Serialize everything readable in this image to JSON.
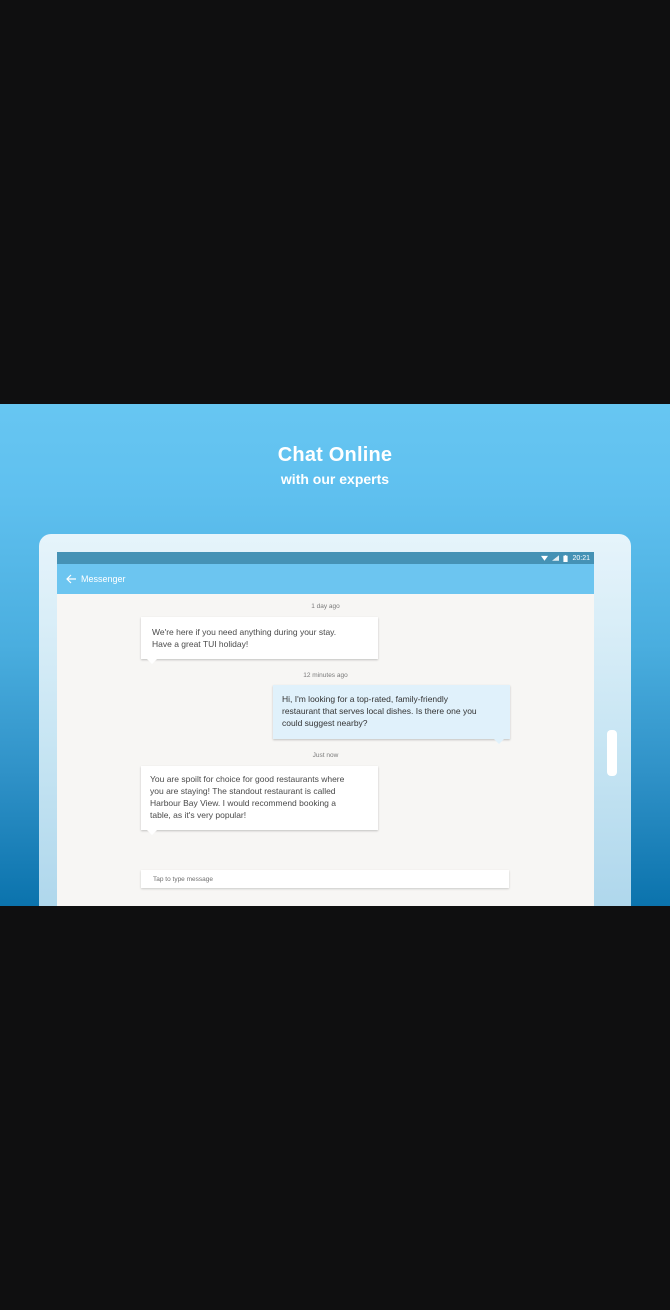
{
  "promo": {
    "title": "Chat Online",
    "subtitle": "with our experts"
  },
  "status_bar": {
    "time": "20:21",
    "icons": [
      "wifi-icon",
      "signal-icon",
      "battery-icon"
    ]
  },
  "app_bar": {
    "title": "Messenger",
    "back_icon": "arrow-left-icon"
  },
  "chat": {
    "messages": [
      {
        "timestamp": "1 day ago",
        "sender": "agent",
        "lines": [
          "We're here if you need anything during your stay.",
          "Have a great TUI holiday!"
        ]
      },
      {
        "timestamp": "12 minutes ago",
        "sender": "user",
        "lines": [
          "Hi, I'm looking for a top-rated, family-friendly",
          "restaurant that serves local dishes. Is there one you",
          "could suggest nearby?"
        ]
      },
      {
        "timestamp": "Just now",
        "sender": "agent",
        "lines": [
          "You are spoilt for choice for good restaurants where",
          "you are staying! The standout restaurant is called",
          "Harbour Bay View. I would recommend booking a",
          "table, as it's very popular!"
        ]
      }
    ]
  },
  "composer": {
    "placeholder": "Tap to type message",
    "value": ""
  },
  "colors": {
    "background": "#0f0f10",
    "banner_top": "#67c6f2",
    "banner_bottom": "#0b73ad",
    "status_bar": "#4592b5",
    "app_bar": "#6cc5f0",
    "user_bubble": "#e0f1fb"
  }
}
